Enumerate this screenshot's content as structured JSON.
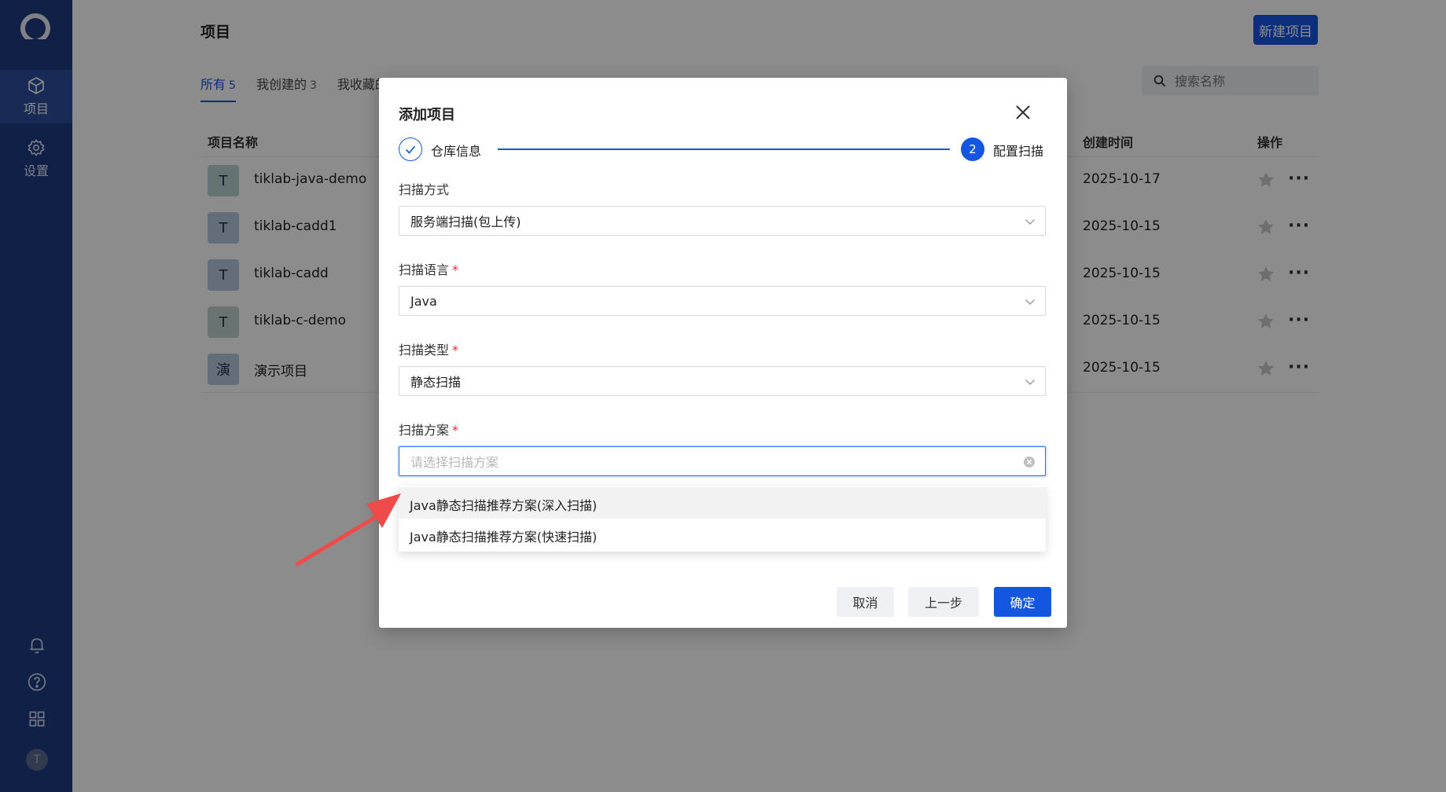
{
  "sidebar": {
    "items": [
      {
        "label": "项目",
        "icon": "cube-icon",
        "active": true
      },
      {
        "label": "设置",
        "icon": "gear-icon",
        "active": false
      }
    ],
    "bottom_icons": [
      "bell-icon",
      "help-icon",
      "apps-grid-icon"
    ],
    "avatar": "T"
  },
  "header": {
    "title": "项目",
    "new_button": "新建项目"
  },
  "tabs": [
    {
      "label": "所有",
      "count": "5"
    },
    {
      "label": "我创建的",
      "count": "3"
    },
    {
      "label": "我收藏的",
      "count": ""
    }
  ],
  "search": {
    "placeholder": "搜索名称"
  },
  "table": {
    "headers": {
      "name": "项目名称",
      "created": "创建时间",
      "actions": "操作"
    },
    "rows": [
      {
        "avatar": "T",
        "name": "tiklab-java-demo",
        "created": "2025-10-17"
      },
      {
        "avatar": "T",
        "name": "tiklab-cadd1",
        "created": "2025-10-15"
      },
      {
        "avatar": "T",
        "name": "tiklab-cadd",
        "created": "2025-10-15"
      },
      {
        "avatar": "T",
        "name": "tiklab-c-demo",
        "created": "2025-10-15"
      },
      {
        "avatar": "演",
        "name": "演示项目",
        "created": "2025-10-15"
      }
    ],
    "more": "···"
  },
  "modal": {
    "title": "添加项目",
    "steps": [
      {
        "label": "仓库信息",
        "state": "done"
      },
      {
        "label": "配置扫描",
        "number": "2",
        "state": "current"
      }
    ],
    "fields": {
      "scan_mode": {
        "label": "扫描方式",
        "value": "服务端扫描(包上传)"
      },
      "scan_language": {
        "label": "扫描语言",
        "value": "Java",
        "required": "*"
      },
      "scan_type": {
        "label": "扫描类型",
        "value": "静态扫描",
        "required": "*"
      },
      "scan_plan": {
        "label": "扫描方案",
        "placeholder": "请选择扫描方案",
        "required": "*"
      }
    },
    "dropdown_options": [
      "Java静态扫描推荐方案(深入扫描)",
      "Java静态扫描推荐方案(快速扫描)"
    ],
    "buttons": {
      "cancel": "取消",
      "prev": "上一步",
      "confirm": "确定"
    }
  },
  "colors": {
    "sidebar": "#1f3b82",
    "primary": "#1456e0",
    "required": "#f5222d",
    "annotation_arrow": "#f04b4b"
  }
}
